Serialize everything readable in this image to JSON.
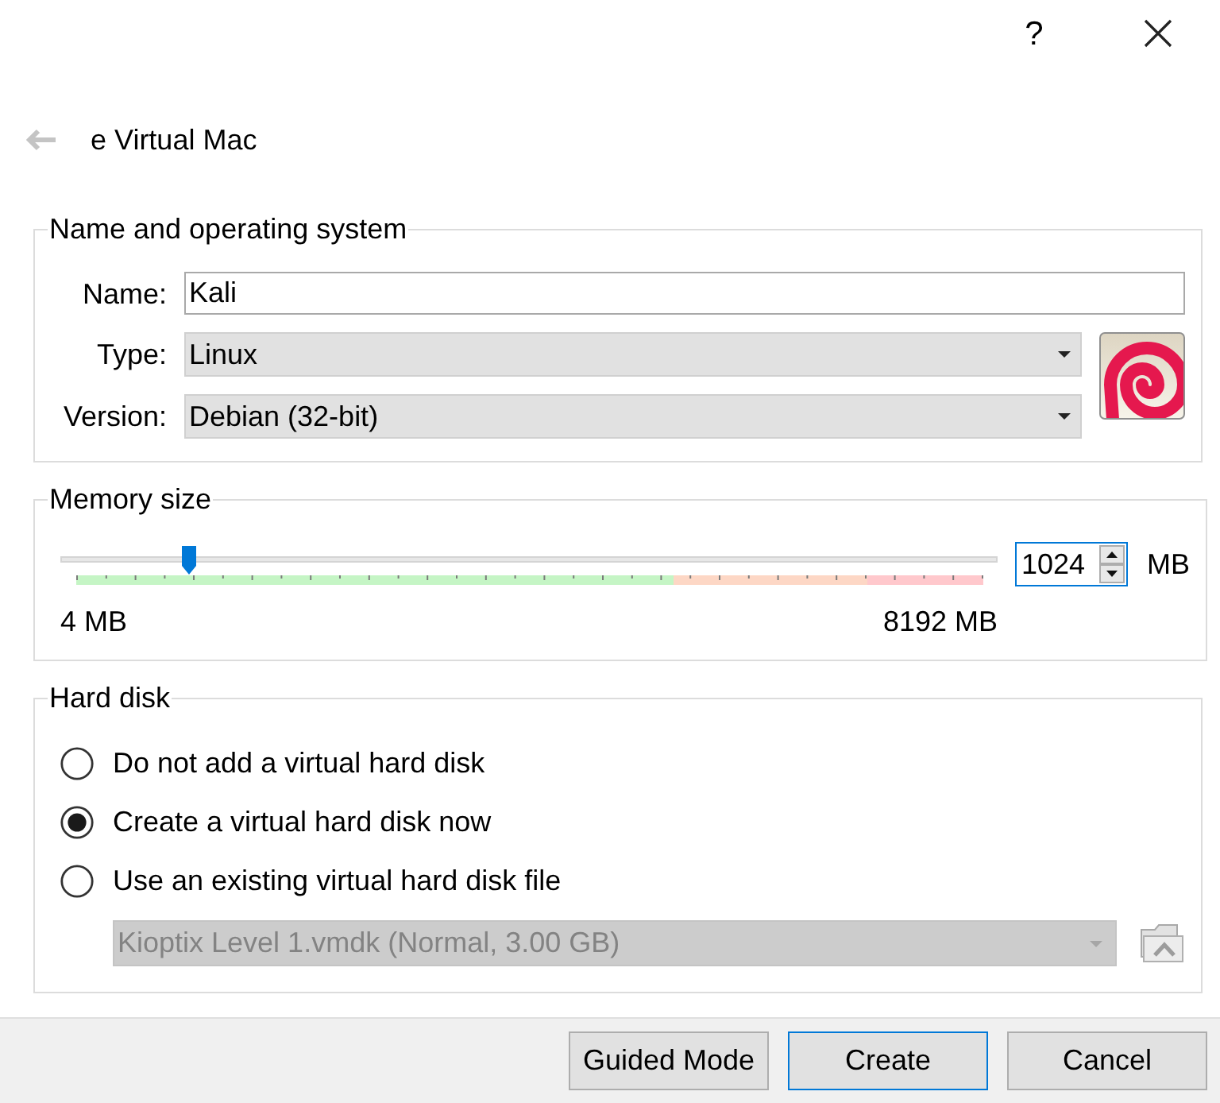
{
  "window": {
    "help": "?"
  },
  "header": {
    "title": "e Virtual Mac"
  },
  "name_and_os": {
    "title": "Name and operating system",
    "fields": [
      {
        "kind": "text",
        "label": "Name:",
        "value": "Kali"
      },
      {
        "kind": "dropdown",
        "label": "Type:",
        "value": "Linux"
      },
      {
        "kind": "dropdown",
        "label": "Version:",
        "value": "Debian (32-bit)"
      }
    ]
  },
  "memory_size": {
    "title": "Memory size",
    "level": 0.125,
    "min_label": "4 MB",
    "max_label": "8192 MB",
    "value": "1024",
    "unit": "MB"
  },
  "hard_disk": {
    "title": "Hard disk",
    "options": [
      {
        "label": "Do not add a virtual hard disk",
        "selected": false
      },
      {
        "label": "Create a virtual hard disk now",
        "selected": true
      },
      {
        "label": "Use an existing virtual hard disk file",
        "selected": false
      }
    ],
    "file": {
      "value": "Kioptix Level 1.vmdk (Normal, 3.00 GB)",
      "disabled": true
    }
  },
  "buttons": [
    {
      "label": "Guided Mode",
      "default": false
    },
    {
      "label": "Create",
      "default": true
    },
    {
      "label": "Cancel",
      "default": false
    }
  ]
}
